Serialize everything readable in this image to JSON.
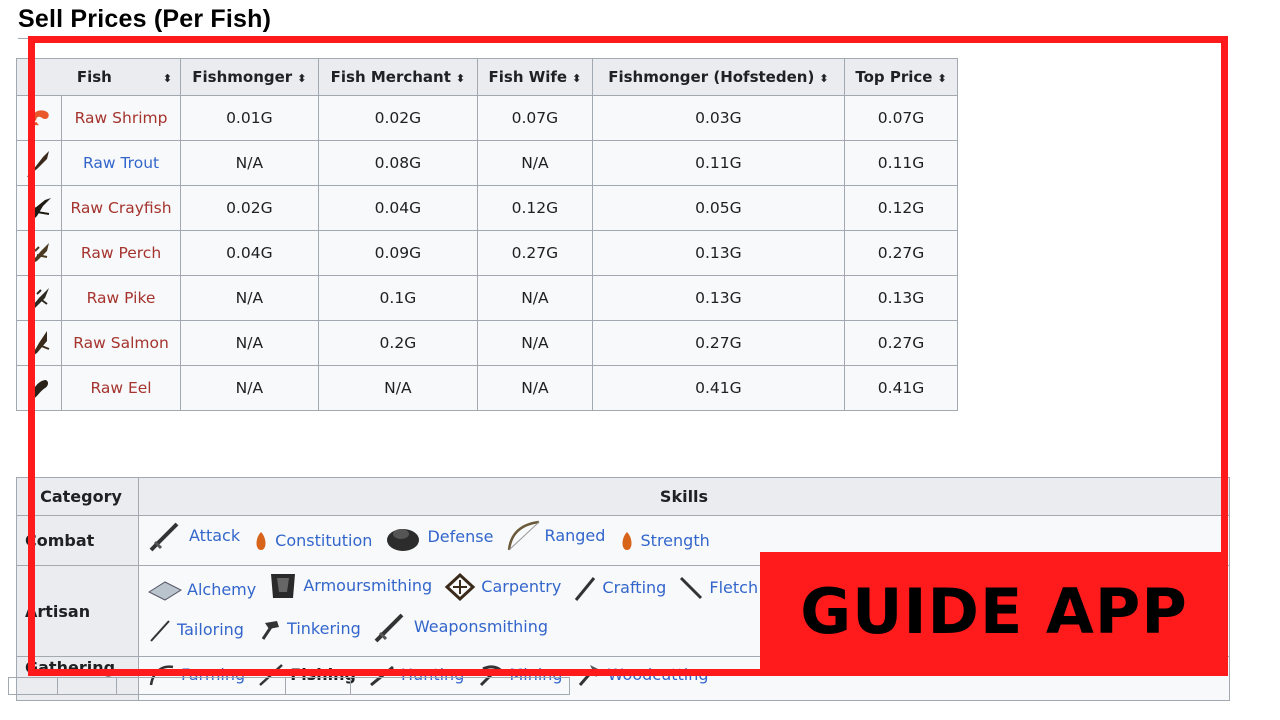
{
  "section_title": "Sell Prices (Per Fish)",
  "prices_table": {
    "headers": [
      "Fish",
      "Fishmonger",
      "Fish Merchant",
      "Fish Wife",
      "Fishmonger (Hofsteden)",
      "Top Price"
    ],
    "sort_glyph": "⬍",
    "rows": [
      {
        "name": "Raw Shrimp",
        "fishmonger": "0.01G",
        "merchant": "0.02G",
        "wife": "0.07G",
        "hofsteden": "0.03G",
        "top": "0.07G",
        "icon": "shrimp-icon"
      },
      {
        "name": "Raw Trout",
        "fishmonger": "N/A",
        "merchant": "0.08G",
        "wife": "N/A",
        "hofsteden": "0.11G",
        "top": "0.11G",
        "icon": "trout-icon"
      },
      {
        "name": "Raw Crayfish",
        "fishmonger": "0.02G",
        "merchant": "0.04G",
        "wife": "0.12G",
        "hofsteden": "0.05G",
        "top": "0.12G",
        "icon": "crayfish-icon"
      },
      {
        "name": "Raw Perch",
        "fishmonger": "0.04G",
        "merchant": "0.09G",
        "wife": "0.27G",
        "hofsteden": "0.13G",
        "top": "0.27G",
        "icon": "perch-icon"
      },
      {
        "name": "Raw Pike",
        "fishmonger": "N/A",
        "merchant": "0.1G",
        "wife": "N/A",
        "hofsteden": "0.13G",
        "top": "0.13G",
        "icon": "pike-icon"
      },
      {
        "name": "Raw Salmon",
        "fishmonger": "N/A",
        "merchant": "0.2G",
        "wife": "N/A",
        "hofsteden": "0.27G",
        "top": "0.27G",
        "icon": "salmon-icon"
      },
      {
        "name": "Raw Eel",
        "fishmonger": "N/A",
        "merchant": "N/A",
        "wife": "N/A",
        "hofsteden": "0.41G",
        "top": "0.41G",
        "icon": "eel-icon"
      }
    ]
  },
  "skills_table": {
    "header_category": "Category",
    "header_skills": "Skills",
    "combat": {
      "label": "Combat",
      "skills": [
        "Attack",
        "Constitution",
        "Defense",
        "Ranged",
        "Strength"
      ]
    },
    "artisan": {
      "label": "Artisan",
      "skills": [
        "Alchemy",
        "Armoursmithing",
        "Carpentry",
        "Crafting",
        "Fletch",
        "Tailoring",
        "Tinkering",
        "Weaponsmithing"
      ]
    },
    "gathering": {
      "label": "Gathering",
      "skills": [
        "Farming",
        "Fishing",
        "Hunting",
        "Mining",
        "Woodcutting"
      ]
    }
  },
  "overlay": {
    "banner_text": "GUIDE APP",
    "frame_color": "#ff1b1b"
  }
}
